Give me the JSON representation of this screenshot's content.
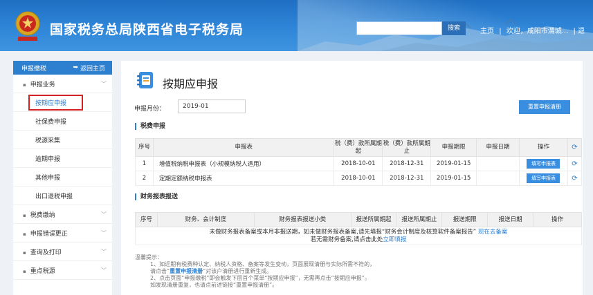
{
  "header": {
    "title": "国家税务总局陕西省电子税务局",
    "search_button": "搜索",
    "home_link": "主页",
    "separator": "|",
    "welcome": "欢迎，咸阳市渭城...",
    "trailing": "| 退"
  },
  "sidebar": {
    "heading": "申报缴税",
    "back_label": "返回主页",
    "groups": [
      {
        "label": "申报业务"
      },
      {
        "label": "税费缴纳"
      },
      {
        "label": "申报错误更正"
      },
      {
        "label": "查询及打印"
      },
      {
        "label": "重点税源"
      }
    ],
    "items": [
      {
        "label": "按期应申报"
      },
      {
        "label": "社保费申报"
      },
      {
        "label": "税源采集"
      },
      {
        "label": "逾期申报"
      },
      {
        "label": "其他申报"
      },
      {
        "label": "出口退税申报"
      }
    ]
  },
  "main": {
    "title": "按期应申报",
    "month_label": "申报月份：",
    "month_value": "2019-01",
    "reset_button": "重置申报清册",
    "section1": "税费申报",
    "section2": "财务报表报送",
    "tax_table": {
      "headers": [
        "序号",
        "申报表",
        "税（费）款所属期起",
        "税（费）款所属期止",
        "申报期限",
        "申报日期",
        "操作"
      ],
      "rows": [
        {
          "no": "1",
          "form": "增值税纳税申报表（小规模纳税人适用）",
          "start": "2018-10-01",
          "end": "2018-12-31",
          "deadline": "2019-01-15",
          "date": "",
          "action": "填写申报表"
        },
        {
          "no": "2",
          "form": "定期定额纳税申报表",
          "start": "2018-10-01",
          "end": "2018-12-31",
          "deadline": "2019-01-15",
          "date": "",
          "action": "填写申报表"
        }
      ]
    },
    "fin_table": {
      "headers": [
        "序号",
        "财务、会计制度",
        "财务报表报送小类",
        "报送所属期起",
        "报送所属期止",
        "报送期限",
        "报送日期",
        "操作"
      ],
      "msg1": "未做财务报表备案或本月非报送期，如未做财务报表备案,请先填报“财务会计制度及核算软件备案报告”",
      "msg1_link": "现在去备案",
      "msg2": "若无需财务备案,请点击此处",
      "msg2_link": "立即填报"
    },
    "tips": {
      "label": "温馨提示：",
      "line1": "1、如近期有税费种认定、纳税人资格、备案等发生变动，页面展现清册与实际所需不符的，",
      "line2a": "请点击“",
      "line2b": "重置申报清册",
      "line2c": "”对该户清册进行重新生成。",
      "line3": "2、点击页面“申报缴税”即会触发下层首个菜单“按期应申报”，无需再点击“按期应申报”。",
      "line4": "如发现清册重复，也请点前述链接“重置申报清册”。"
    }
  },
  "colors": {
    "header_blue": "#2f86d8",
    "accent": "#2d7fd0",
    "button": "#3a8ee0",
    "highlight_box": "#d42020"
  }
}
